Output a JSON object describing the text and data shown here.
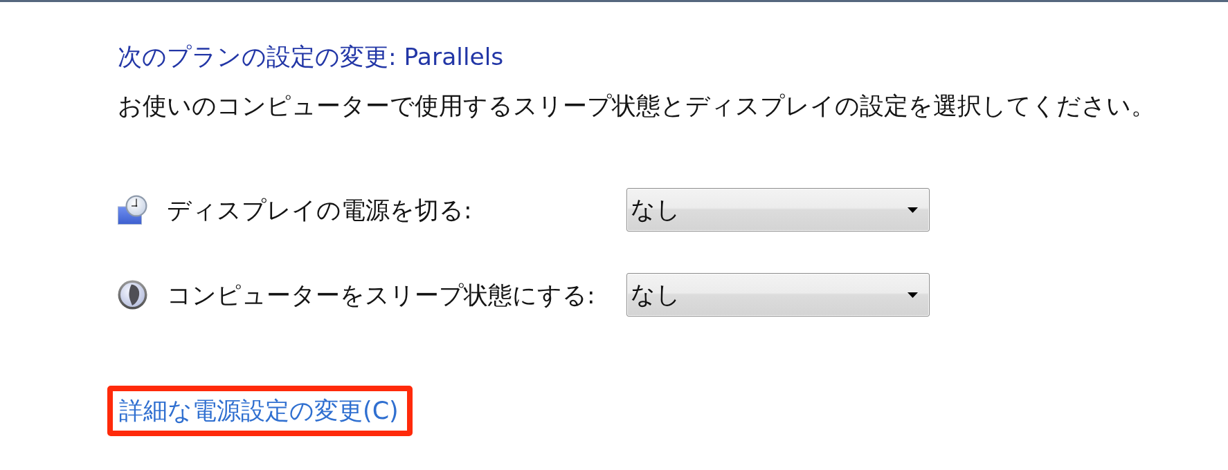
{
  "page": {
    "heading": "次のプランの設定の変更: Parallels",
    "description": "お使いのコンピューターで使用するスリープ状態とディスプレイの設定を選択してください。"
  },
  "settings": [
    {
      "kind": "display",
      "label": "ディスプレイの電源を切る:",
      "value": "なし"
    },
    {
      "kind": "sleep",
      "label": "コンピューターをスリープ状態にする:",
      "value": "なし"
    }
  ],
  "link": {
    "text": "詳細な電源設定の変更(C)",
    "highlighted": true
  }
}
